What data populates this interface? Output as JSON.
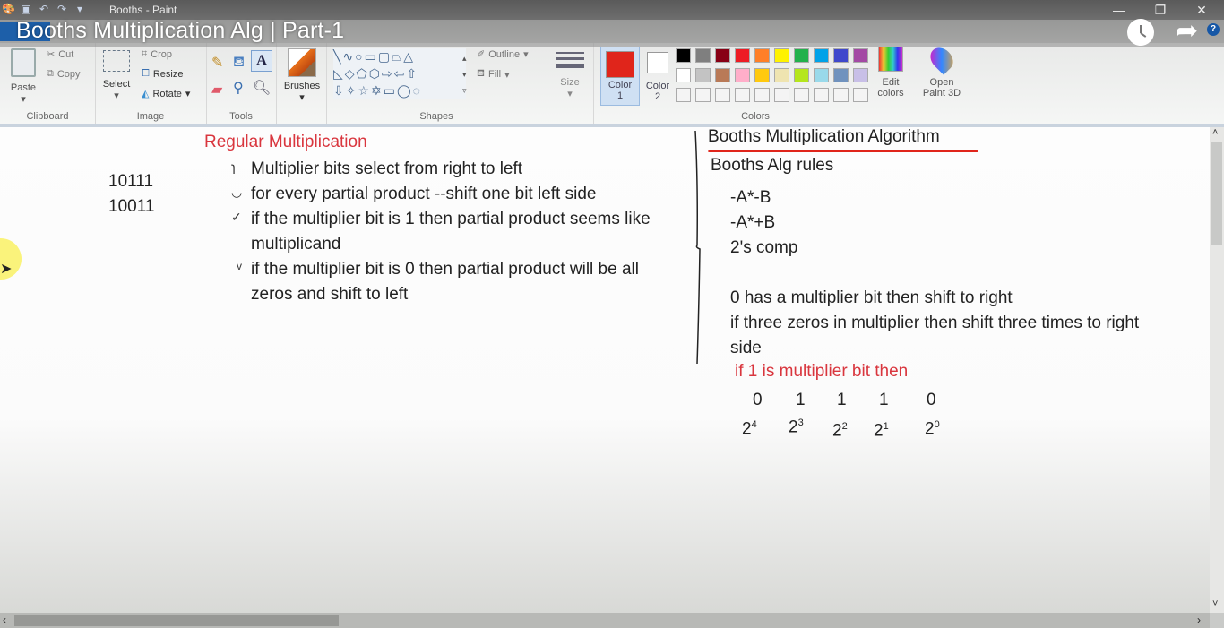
{
  "window": {
    "title": "Booths - Paint",
    "controls": {
      "minimize": "—",
      "restore": "❐",
      "close": "✕"
    }
  },
  "video_overlay": {
    "title": "Booths Multiplication Alg | Part-1",
    "icons": [
      "watch-later-icon",
      "share-icon",
      "help-icon"
    ]
  },
  "ribbon": {
    "clipboard": {
      "label": "Clipboard",
      "paste": "Paste",
      "cut": "Cut",
      "copy": "Copy"
    },
    "image": {
      "label": "Image",
      "select": "Select",
      "crop": "Crop",
      "resize": "Resize",
      "rotate": "Rotate"
    },
    "tools": {
      "label": "Tools"
    },
    "brushes": {
      "label": "Brushes"
    },
    "shapes": {
      "label": "Shapes",
      "outline": "Outline",
      "fill": "Fill"
    },
    "size": {
      "label": "Size"
    },
    "colors": {
      "label": "Colors",
      "color1": {
        "label1": "Color",
        "label2": "1",
        "value": "#e0251b"
      },
      "color2": {
        "label1": "Color",
        "label2": "2",
        "value": "#ffffff"
      },
      "palette_row1": [
        "#000000",
        "#7f7f7f",
        "#880015",
        "#ed1c24",
        "#ff7f27",
        "#fff200",
        "#22b14c",
        "#00a2e8",
        "#3f48cc",
        "#a349a4"
      ],
      "palette_row2": [
        "#ffffff",
        "#c3c3c3",
        "#b97a57",
        "#ffaec9",
        "#ffc90e",
        "#efe4b0",
        "#b5e61d",
        "#99d9ea",
        "#7092be",
        "#c8bfe7"
      ],
      "edit_colors": {
        "line1": "Edit",
        "line2": "colors"
      },
      "open_paint3d": {
        "line1": "Open",
        "line2": "Paint 3D"
      }
    }
  },
  "canvas": {
    "numbers": [
      "10111",
      "10011"
    ],
    "regular": {
      "heading": "Regular Multiplication",
      "lines": [
        "Multiplier bits select from right to left",
        "for every partial product --shift one bit left side",
        "if the multiplier bit is 1 then partial product seems like",
        "multiplicand",
        "if the multiplier bit is 0 then partial product will be all",
        "zeros and shift to left"
      ]
    },
    "booths": {
      "heading": "Booths Multiplication Algorithm",
      "subheading": "Booths Alg rules",
      "rules": [
        "-A*-B",
        "-A*+B",
        "2's comp"
      ],
      "notes": [
        "0 has a multiplier bit then shift to right",
        "if three zeros in multiplier then shift three times to right",
        "side"
      ],
      "red_note": "if 1 is multiplier bit then",
      "bits": [
        "0",
        "1",
        "1",
        "1",
        "0"
      ],
      "powers": [
        {
          "base": "2",
          "exp": "4"
        },
        {
          "base": "2",
          "exp": "3"
        },
        {
          "base": "2",
          "exp": "2"
        },
        {
          "base": "2",
          "exp": "1"
        },
        {
          "base": "2",
          "exp": "0"
        }
      ]
    }
  }
}
